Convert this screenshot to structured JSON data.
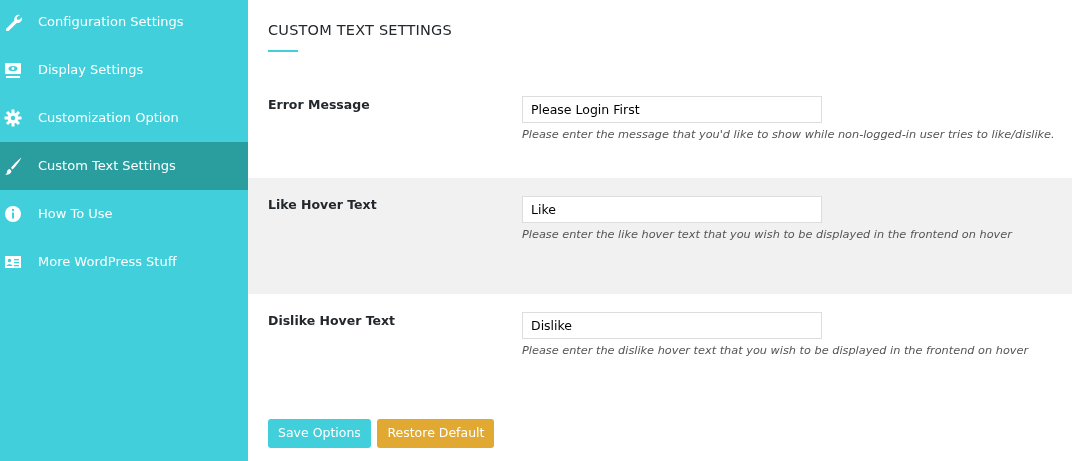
{
  "sidebar": {
    "items": [
      {
        "label": "Configuration Settings",
        "kind": "wrench",
        "selected": false
      },
      {
        "label": "Display Settings",
        "kind": "display",
        "selected": false
      },
      {
        "label": "Customization Option",
        "kind": "gear",
        "selected": false
      },
      {
        "label": "Custom Text Settings",
        "kind": "brush",
        "selected": true
      },
      {
        "label": "How To Use",
        "kind": "info",
        "selected": false
      },
      {
        "label": "More WordPress Stuff",
        "kind": "card",
        "selected": false
      }
    ]
  },
  "heading": "CUSTOM TEXT SETTINGS",
  "fields": [
    {
      "label": "Error Message",
      "value": "Please Login First",
      "help": "Please enter the message that you'd like to show while non-logged-in user tries to like/dislike.",
      "shaded": false
    },
    {
      "label": "Like Hover Text",
      "value": "Like",
      "help": "Please enter the like hover text that you wish to be displayed in the frontend on hover",
      "shaded": true
    },
    {
      "label": "Dislike Hover Text",
      "value": "Dislike",
      "help": "Please enter the dislike hover text that you wish to be displayed in the frontend on hover",
      "shaded": false
    }
  ],
  "buttons": [
    {
      "label": "Save Options",
      "kind": "save"
    },
    {
      "label": "Restore Default",
      "kind": "restore"
    }
  ]
}
